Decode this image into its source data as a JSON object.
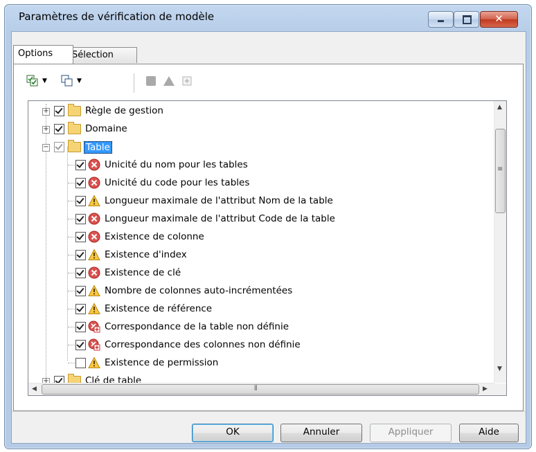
{
  "window": {
    "title": "Paramètres de vérification de modèle",
    "controls": [
      "minimize",
      "maximize",
      "close"
    ]
  },
  "tabs": [
    {
      "label": "Options",
      "selected": true
    },
    {
      "label": "Sélection",
      "selected": false
    }
  ],
  "toolbar": {
    "items": [
      {
        "icon": "check-all-icon",
        "dropdown": true
      },
      {
        "icon": "uncheck-all-icon",
        "dropdown": true
      },
      {
        "icon": "error-severity-icon",
        "dropdown": false,
        "disabled": true
      },
      {
        "icon": "warning-severity-icon",
        "dropdown": false,
        "disabled": true
      },
      {
        "icon": "auto-correct-icon",
        "dropdown": false,
        "disabled": true
      }
    ]
  },
  "tree": {
    "items": [
      {
        "label": "Règle de gestion",
        "level": 0,
        "expander": "+",
        "checked": true,
        "icon": "folder-icon"
      },
      {
        "label": "Domaine",
        "level": 0,
        "expander": "+",
        "checked": true,
        "icon": "folder-icon"
      },
      {
        "label": "Table",
        "level": 0,
        "expander": "-",
        "checked": "partial",
        "icon": "folder-icon",
        "selected": true
      },
      {
        "label": "Unicité du nom pour les tables",
        "level": 1,
        "checked": true,
        "icon": "error-icon"
      },
      {
        "label": "Unicité du code pour les tables",
        "level": 1,
        "checked": true,
        "icon": "error-icon"
      },
      {
        "label": "Longueur maximale de l'attribut Nom de la table",
        "level": 1,
        "checked": true,
        "icon": "warning-icon"
      },
      {
        "label": "Longueur maximale de l'attribut Code de la table",
        "level": 1,
        "checked": true,
        "icon": "error-icon"
      },
      {
        "label": "Existence de colonne",
        "level": 1,
        "checked": true,
        "icon": "error-icon"
      },
      {
        "label": "Existence d'index",
        "level": 1,
        "checked": true,
        "icon": "warning-icon"
      },
      {
        "label": "Existence de clé",
        "level": 1,
        "checked": true,
        "icon": "error-icon"
      },
      {
        "label": "Nombre de colonnes auto-incrémentées",
        "level": 1,
        "checked": true,
        "icon": "warning-icon"
      },
      {
        "label": "Existence de référence",
        "level": 1,
        "checked": true,
        "icon": "warning-icon"
      },
      {
        "label": "Correspondance de la table non définie",
        "level": 1,
        "checked": true,
        "icon": "error-autofix-icon"
      },
      {
        "label": "Correspondance des colonnes non définie",
        "level": 1,
        "checked": true,
        "icon": "error-autofix-icon"
      },
      {
        "label": "Existence de permission",
        "level": 1,
        "checked": false,
        "icon": "warning-icon"
      },
      {
        "label": "Clé de table",
        "level": 0,
        "expander": "+",
        "checked": true,
        "icon": "folder-icon"
      }
    ]
  },
  "buttons": {
    "ok": "OK",
    "cancel": "Annuler",
    "apply": "Appliquer",
    "help": "Aide"
  }
}
